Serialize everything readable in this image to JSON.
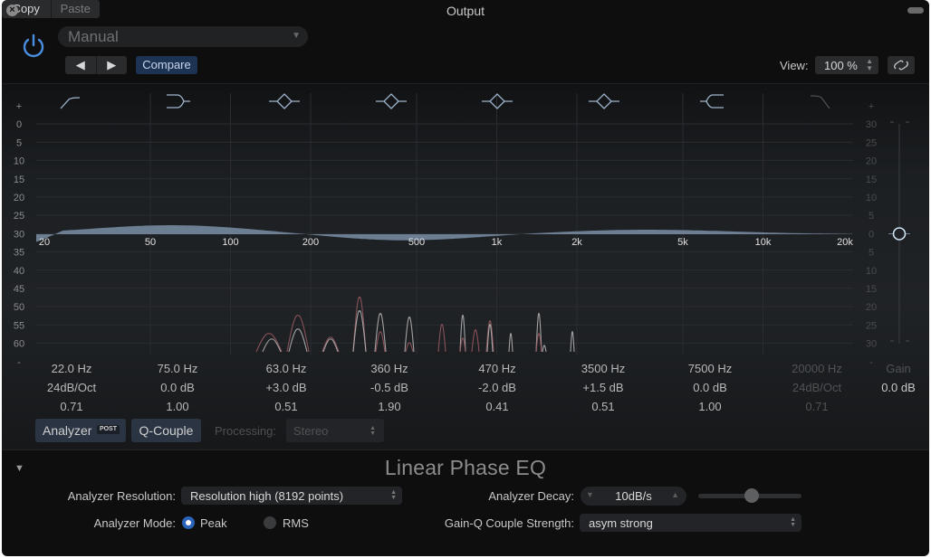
{
  "window": {
    "title": "Output"
  },
  "header": {
    "preset": "Manual",
    "prev_label": "◀",
    "next_label": "▶",
    "compare_label": "Compare",
    "copy_label": "Copy",
    "paste_label": "Paste",
    "view_label": "View:",
    "view_value": "100 %",
    "link_icon": "link-icon"
  },
  "graph": {
    "band_icons": [
      "highpass-slope",
      "low-shelf",
      "bell",
      "bell",
      "bell",
      "bell",
      "high-shelf",
      "lowpass-slope"
    ],
    "left_scale": [
      "+",
      "0",
      "5",
      "10",
      "15",
      "20",
      "25",
      "30",
      "35",
      "40",
      "45",
      "50",
      "55",
      "60",
      "-"
    ],
    "right_scale": [
      "+",
      "30",
      "25",
      "20",
      "15",
      "10",
      "5",
      "0",
      "5",
      "10",
      "15",
      "20",
      "25",
      "30",
      "-"
    ],
    "freq_labels": [
      "20",
      "50",
      "100",
      "200",
      "500",
      "1k",
      "2k",
      "5k",
      "10k",
      "20k"
    ],
    "curve_color": "#7a8ea6",
    "analyzer_peak_color": "#9a5a62",
    "analyzer_rms_color": "#b8b8b8"
  },
  "bands": [
    {
      "freq": "22.0 Hz",
      "gain": "24dB/Oct",
      "q": "0.71",
      "enabled": true
    },
    {
      "freq": "75.0 Hz",
      "gain": "0.0 dB",
      "q": "1.00",
      "enabled": true
    },
    {
      "freq": "63.0 Hz",
      "gain": "+3.0 dB",
      "q": "0.51",
      "enabled": true
    },
    {
      "freq": "360 Hz",
      "gain": "-0.5 dB",
      "q": "1.90",
      "enabled": true
    },
    {
      "freq": "470 Hz",
      "gain": "-2.0 dB",
      "q": "0.41",
      "enabled": true
    },
    {
      "freq": "3500 Hz",
      "gain": "+1.5 dB",
      "q": "0.51",
      "enabled": true
    },
    {
      "freq": "7500 Hz",
      "gain": "0.0 dB",
      "q": "1.00",
      "enabled": true
    },
    {
      "freq": "20000 Hz",
      "gain": "24dB/Oct",
      "q": "0.71",
      "enabled": false
    }
  ],
  "master_gain": {
    "label": "Gain",
    "value": "0.0 dB",
    "level_db": 0
  },
  "controls": {
    "analyzer_label": "Analyzer",
    "analyzer_badge": "POST",
    "qcouple_label": "Q-Couple",
    "processing_label": "Processing:",
    "processing_value": "Stereo"
  },
  "extended": {
    "plugin_name": "Linear Phase EQ",
    "analyzer_resolution_label": "Analyzer Resolution:",
    "analyzer_resolution_value": "Resolution high (8192 points)",
    "analyzer_mode_label": "Analyzer Mode:",
    "mode_peak": "Peak",
    "mode_rms": "RMS",
    "selected_mode": "Peak",
    "analyzer_decay_label": "Analyzer Decay:",
    "analyzer_decay_value": "10dB/s",
    "decay_slider_fraction": 0.5,
    "gainq_label": "Gain-Q Couple Strength:",
    "gainq_value": "asym strong"
  }
}
